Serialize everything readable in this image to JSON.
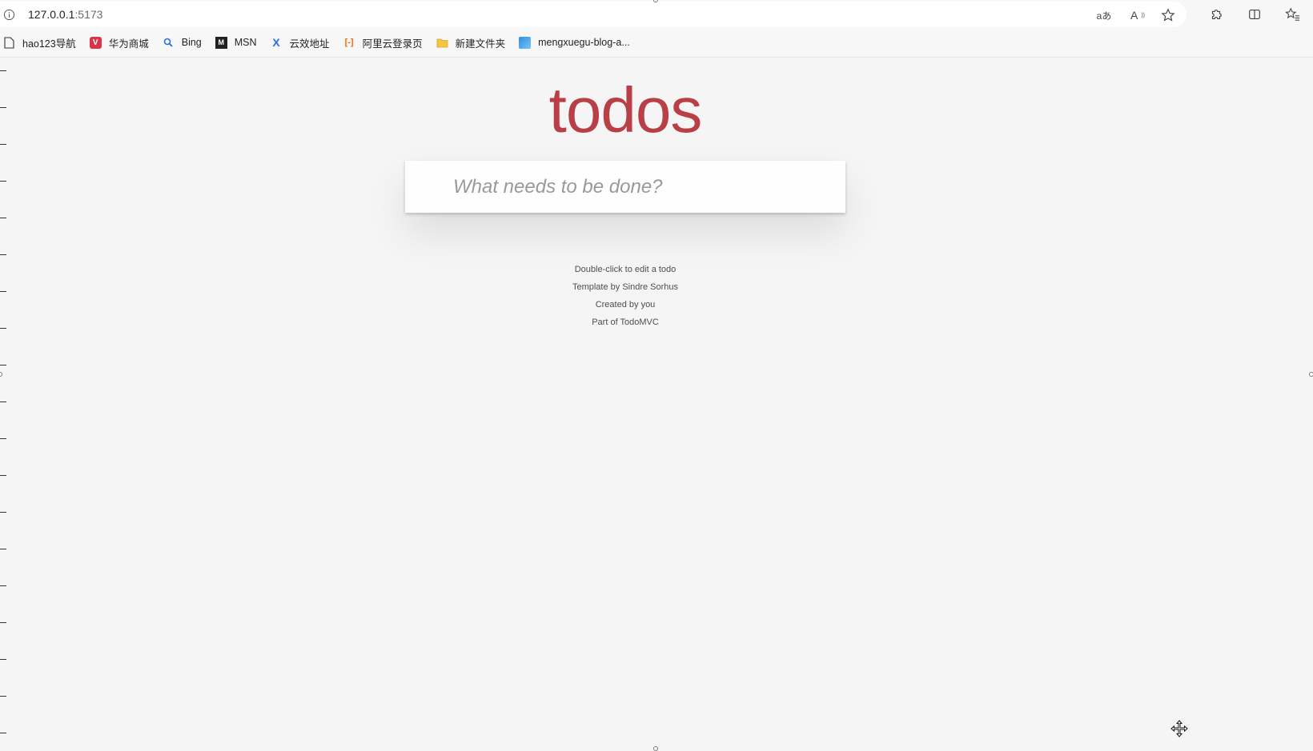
{
  "browser": {
    "url_host": "127.0.0.1",
    "url_port": ":5173",
    "icons": [
      "info-icon",
      "translate-icon",
      "read-aloud-icon",
      "favorite-star-icon",
      "extensions-icon",
      "split-screen-icon",
      "favorites-list-icon"
    ],
    "read_aloud_label": "A",
    "translate_label": "aあ"
  },
  "bookmarks": [
    {
      "label": "hao123导航",
      "icon": "page-icon"
    },
    {
      "label": "华为商城",
      "icon": "huawei-icon"
    },
    {
      "label": "Bing",
      "icon": "search-icon"
    },
    {
      "label": "MSN",
      "icon": "msn-icon"
    },
    {
      "label": "云效地址",
      "icon": "yunxiao-icon"
    },
    {
      "label": "阿里云登录页",
      "icon": "aliyun-icon"
    },
    {
      "label": "新建文件夹",
      "icon": "folder-icon"
    },
    {
      "label": "mengxuegu-blog-a...",
      "icon": "site-icon"
    }
  ],
  "app": {
    "title": "todos",
    "input_placeholder": "What needs to be done?",
    "info": {
      "line1": "Double-click to edit a todo",
      "line2_prefix": "Template by ",
      "line2_link": "Sindre Sorhus",
      "line3_prefix": "Created by ",
      "line3_link": "you",
      "line4_prefix": "Part of ",
      "line4_link": "TodoMVC"
    }
  },
  "colors": {
    "title": "#b83f45",
    "background": "#f5f5f5",
    "text": "#4d4d4d"
  }
}
